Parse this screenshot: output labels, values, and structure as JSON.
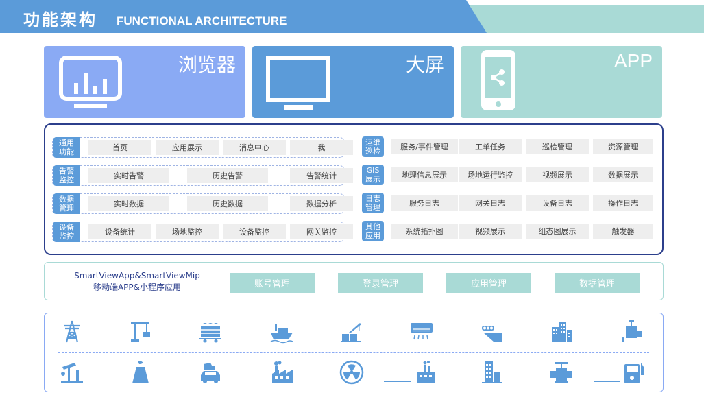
{
  "header": {
    "title_zh": "功能架构",
    "title_en": "FUNCTIONAL ARCHITECTURE"
  },
  "clients": {
    "browser": "浏览器",
    "screen": "大屏",
    "app": "APP"
  },
  "modules": {
    "left": [
      {
        "label": "通用\n功能",
        "items": [
          "首页",
          "应用展示",
          "消息中心",
          "我"
        ]
      },
      {
        "label": "告警\n监控",
        "items": [
          "实时告警",
          "历史告警",
          "告警统计"
        ]
      },
      {
        "label": "数据\n管理",
        "items": [
          "实时数据",
          "历史数据",
          "数据分析"
        ]
      },
      {
        "label": "设备\n监控",
        "items": [
          "设备统计",
          "场地监控",
          "设备监控",
          "网关监控"
        ]
      }
    ],
    "right": [
      {
        "label": "运维\n巡检",
        "items": [
          "服务/事件管理",
          "工单任务",
          "巡检管理",
          "资源管理"
        ]
      },
      {
        "label": "GIS\n展示",
        "items": [
          "地理信息展示",
          "场地运行监控",
          "视频展示",
          "数据展示"
        ]
      },
      {
        "label": "日志\n管理",
        "items": [
          "服务日志",
          "网关日志",
          "设备日志",
          "操作日志"
        ]
      },
      {
        "label": "其他\n应用",
        "items": [
          "系统拓扑图",
          "视频展示",
          "组态图展示",
          "触发器"
        ]
      }
    ]
  },
  "mobile": {
    "title_line1": "SmartViewApp&SmartViewMip",
    "title_line2": "移动端APP&小程序应用",
    "buttons": [
      "账号管理",
      "登录管理",
      "应用管理",
      "数据管理"
    ]
  },
  "industry_icons": {
    "row1": [
      "power-tower-icon",
      "crane-icon",
      "cargo-train-icon",
      "ship-icon",
      "port-crane-icon",
      "air-conditioner-icon",
      "conveyor-mine-icon",
      "city-buildings-icon",
      "water-tap-icon"
    ],
    "row2": [
      "oil-pump-icon",
      "chimney-plant-icon",
      "gas-station-icon",
      "factory-icon",
      "nuclear-icon",
      "industrial-plant-icon",
      "office-building-icon",
      "valve-icon",
      "fuel-meter-icon"
    ]
  },
  "colors": {
    "blue": "#5b9bd9",
    "light_blue": "#8aaaf4",
    "teal": "#a9dad6",
    "navy": "#2c3f8c"
  }
}
